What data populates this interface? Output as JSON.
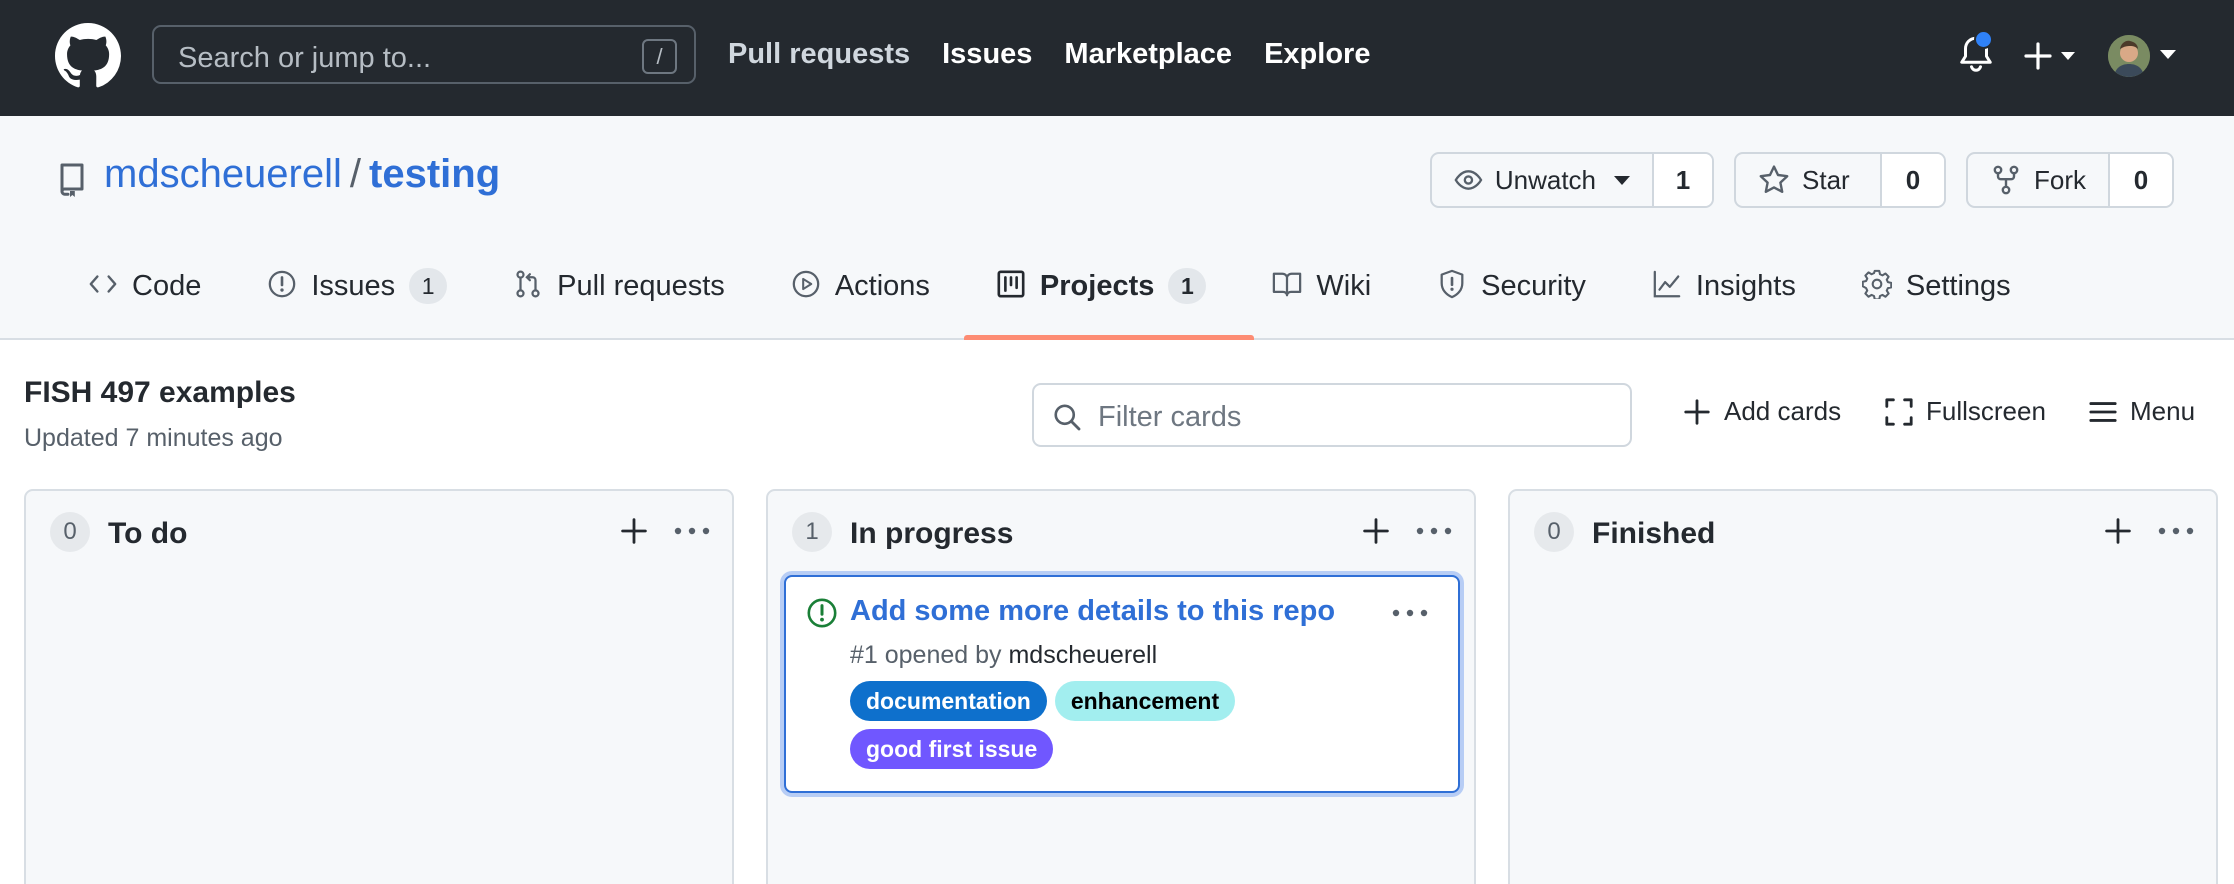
{
  "header": {
    "search_placeholder": "Search or jump to...",
    "search_shortcut": "/",
    "nav": [
      {
        "label": "Pull requests"
      },
      {
        "label": "Issues"
      },
      {
        "label": "Marketplace"
      },
      {
        "label": "Explore"
      }
    ],
    "notification_dot_color": "#2f81f7"
  },
  "repo": {
    "owner": "mdscheuerell",
    "separator": "/",
    "name": "testing",
    "watch": {
      "label": "Unwatch",
      "count": "1"
    },
    "star": {
      "label": "Star",
      "count": "0"
    },
    "fork": {
      "label": "Fork",
      "count": "0"
    }
  },
  "tabs": [
    {
      "label": "Code",
      "icon": "code-icon"
    },
    {
      "label": "Issues",
      "icon": "issue-opened-icon",
      "count": "1"
    },
    {
      "label": "Pull requests",
      "icon": "git-pull-request-icon"
    },
    {
      "label": "Actions",
      "icon": "play-icon"
    },
    {
      "label": "Projects",
      "icon": "project-icon",
      "count": "1",
      "active": true
    },
    {
      "label": "Wiki",
      "icon": "book-icon"
    },
    {
      "label": "Security",
      "icon": "shield-icon"
    },
    {
      "label": "Insights",
      "icon": "graph-icon"
    },
    {
      "label": "Settings",
      "icon": "gear-icon"
    }
  ],
  "project": {
    "title": "FISH 497 examples",
    "updated": "Updated 7 minutes ago",
    "filter_placeholder": "Filter cards",
    "add_cards": "Add cards",
    "fullscreen": "Fullscreen",
    "menu": "Menu"
  },
  "columns": [
    {
      "name": "To do",
      "count": "0",
      "cards": []
    },
    {
      "name": "In progress",
      "count": "1",
      "cards": [
        {
          "title": "Add some more details to this repo",
          "meta_prefix": "#1 opened by",
          "author": "mdscheuerell",
          "labels": [
            {
              "name": "documentation",
              "bg": "#0e70cc",
              "fg": "#ffffff"
            },
            {
              "name": "enhancement",
              "bg": "#a2eeef",
              "fg": "#000000"
            },
            {
              "name": "good first issue",
              "bg": "#7057ff",
              "fg": "#ffffff"
            }
          ]
        }
      ]
    },
    {
      "name": "Finished",
      "count": "0",
      "cards": []
    }
  ],
  "colors": {
    "header_bg": "#24292f",
    "link_blue": "#2f6fd6",
    "active_tab_underline": "#fd8c73",
    "issue_open_green": "#1a7f37"
  }
}
